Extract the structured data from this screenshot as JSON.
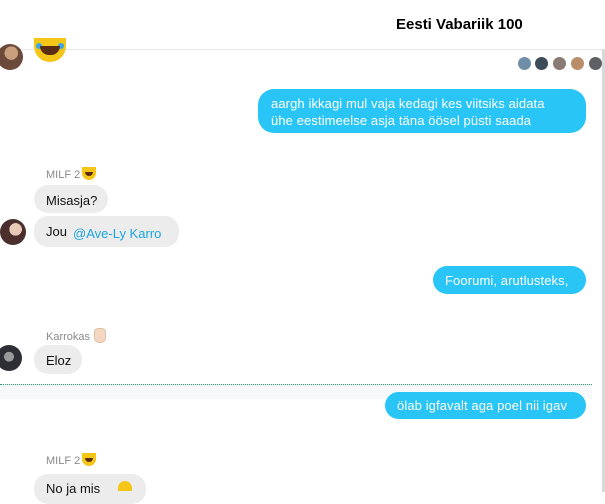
{
  "header": {
    "title": "Eesti Vabariik 100"
  },
  "messages": {
    "out1": "aargh ikkagi mul vaja kedagi kes viitsiks aidata\nühe eestimeelse asja täna öösel püsti saada",
    "out2": "Foorumi, arutlusteks,",
    "out3": "ölab igfavalt aga poel nii igav",
    "in1_sender": "MILF 2",
    "in1_text": "Misasja?",
    "in2_text": "Jou",
    "in2_mention": "@Ave-Ly Karro",
    "in3_sender": "Karrokas",
    "in3_text": "Eloz",
    "in4_sender": "MILF 2",
    "in4_text": "No ja mis"
  },
  "icons": {
    "emoji_laugh": "laughing-tears-emoji-icon",
    "emoji_hand": "ok-hand-emoji-icon"
  },
  "colors": {
    "outgoing_bubble": "#29c5f6",
    "incoming_bubble": "#ececec",
    "mention": "#1aa6e0"
  }
}
